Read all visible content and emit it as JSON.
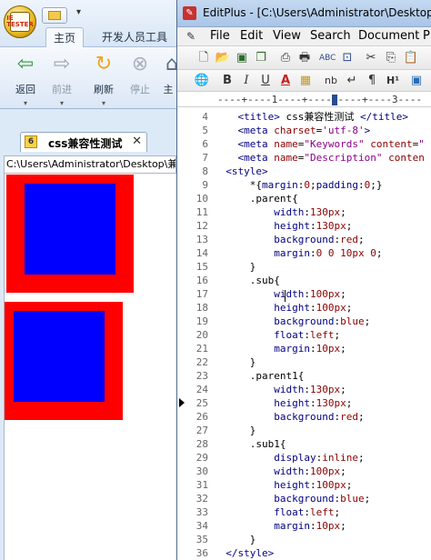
{
  "ietester": {
    "logo_text": "IE TESTER",
    "ribbon_tabs": [
      "主页",
      "开发人员工具"
    ],
    "ribbon_buttons": [
      {
        "label": "返回",
        "icon": "back-arrow-icon",
        "color": "#2e9c3b"
      },
      {
        "label": "前进",
        "icon": "forward-arrow-icon",
        "color": "#9aa4b0"
      },
      {
        "label": "刷新",
        "icon": "refresh-icon",
        "color": "#f0a51c"
      },
      {
        "label": "停止",
        "icon": "stop-icon",
        "color": "#a8b0bb"
      },
      {
        "label": "主",
        "icon": "home-icon",
        "color": "#5a6d85"
      }
    ],
    "document_tab": {
      "icon_label": "6",
      "title": "css兼容性测试",
      "close": "✕"
    },
    "address": "C:\\Users\\Administrator\\Desktop\\兼容",
    "colors": {
      "parent": "#ff0000",
      "sub": "#0000ff"
    }
  },
  "editplus": {
    "window_title": "EditPlus - [C:\\Users\\Administrator\\Desktop\\",
    "menu": [
      "File",
      "Edit",
      "View",
      "Search",
      "Document",
      "P"
    ],
    "toolbar1_icons": [
      "new-file-icon",
      "open-folder-icon",
      "save-icon",
      "save-all-icon",
      "print-preview-icon",
      "print-icon",
      "spellcheck-icon",
      "browser-icon",
      "cut-icon",
      "copy-icon",
      "paste-icon"
    ],
    "toolbar2": [
      {
        "icon": "globe-icon",
        "text": "🌐"
      },
      {
        "icon": "bold-icon",
        "text": "B"
      },
      {
        "icon": "italic-icon",
        "text": "I"
      },
      {
        "icon": "underline-icon",
        "text": "U"
      },
      {
        "icon": "font-color-icon",
        "text": "A"
      },
      {
        "icon": "color-grid-icon",
        "text": "▦"
      },
      {
        "icon": "nbsp-icon",
        "text": "nb"
      },
      {
        "icon": "line-break-icon",
        "text": "↵"
      },
      {
        "icon": "paragraph-icon",
        "text": "¶"
      },
      {
        "icon": "heading-icon",
        "text": "H¹"
      },
      {
        "icon": "image-icon",
        "text": "▣"
      }
    ],
    "ruler": "----+----1----+----2----+----3----",
    "lines": [
      {
        "n": "4",
        "text": "    <title> css兼容性测试 </title>"
      },
      {
        "n": "5",
        "text": "    <meta charset='utf-8'>"
      },
      {
        "n": "6",
        "text": "    <meta name=\"Keywords\" content=\""
      },
      {
        "n": "7",
        "text": "    <meta name=\"Description\" conten"
      },
      {
        "n": "8",
        "text": "  <style>"
      },
      {
        "n": "9",
        "text": "      *{margin:0;padding:0;}"
      },
      {
        "n": "10",
        "text": "      .parent{"
      },
      {
        "n": "11",
        "text": "          width:130px;"
      },
      {
        "n": "12",
        "text": "          height:130px;"
      },
      {
        "n": "13",
        "text": "          background:red;"
      },
      {
        "n": "14",
        "text": "          margin:0 0 10px 0;"
      },
      {
        "n": "15",
        "text": "      }"
      },
      {
        "n": "16",
        "text": "      .sub{"
      },
      {
        "n": "17",
        "text": "          width:100px;"
      },
      {
        "n": "18",
        "text": "          height:100px;"
      },
      {
        "n": "19",
        "text": "          background:blue;"
      },
      {
        "n": "20",
        "text": "          float:left;"
      },
      {
        "n": "21",
        "text": "          margin:10px;"
      },
      {
        "n": "22",
        "text": "      }"
      },
      {
        "n": "23",
        "text": "      .parent1{"
      },
      {
        "n": "24",
        "text": "          width:130px;"
      },
      {
        "n": "25",
        "text": "          height:130px;"
      },
      {
        "n": "26",
        "text": "          background:red;"
      },
      {
        "n": "27",
        "text": "      }"
      },
      {
        "n": "28",
        "text": "      .sub1{"
      },
      {
        "n": "29",
        "text": "          display:inline;"
      },
      {
        "n": "30",
        "text": "          width:100px;"
      },
      {
        "n": "31",
        "text": "          height:100px;"
      },
      {
        "n": "32",
        "text": "          background:blue;"
      },
      {
        "n": "33",
        "text": "          float:left;"
      },
      {
        "n": "34",
        "text": "          margin:10px;"
      },
      {
        "n": "35",
        "text": "      }"
      },
      {
        "n": "36",
        "text": "  </style>"
      }
    ]
  }
}
